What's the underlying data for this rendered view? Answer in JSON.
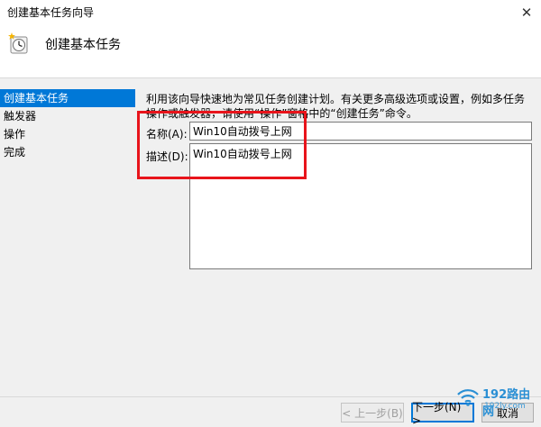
{
  "window": {
    "title": "创建基本任务向导",
    "close_glyph": "✕"
  },
  "header": {
    "title": "创建基本任务",
    "icon": "task-scheduler-icon"
  },
  "sidebar": {
    "items": [
      {
        "label": "创建基本任务",
        "active": true
      },
      {
        "label": "触发器",
        "active": false
      },
      {
        "label": "操作",
        "active": false
      },
      {
        "label": "完成",
        "active": false
      }
    ]
  },
  "main": {
    "description": "利用该向导快速地为常见任务创建计划。有关更多高级选项或设置，例如多任务操作或触发器，请使用“操作”窗格中的“创建任务”命令。",
    "name_label": "名称(A):",
    "name_value": "Win10自动拨号上网",
    "desc_label": "描述(D):",
    "desc_value": "Win10自动拨号上网"
  },
  "footer": {
    "back_label": "< 上一步(B)",
    "next_label": "下一步(N) >",
    "cancel_label": "取消"
  },
  "watermark": {
    "brand": "192路由网",
    "url": "192ly.com"
  },
  "colors": {
    "accent": "#0078d7",
    "highlight": "#e8141b",
    "watermark": "#2a8fd4"
  }
}
